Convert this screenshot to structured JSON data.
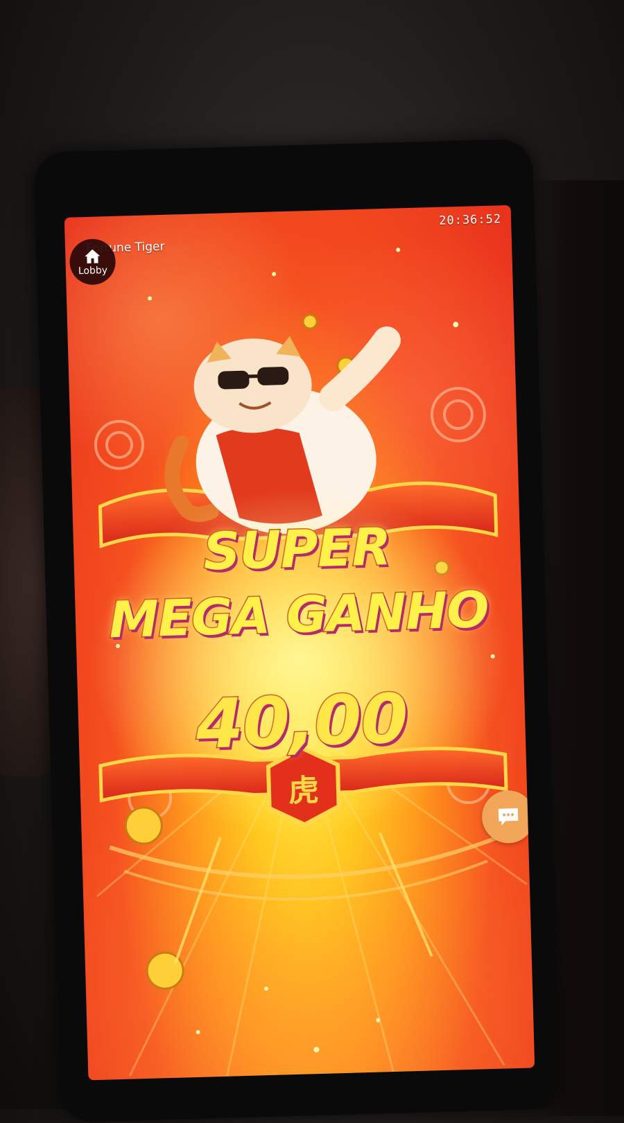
{
  "status_bar": {
    "time": "20:36:52"
  },
  "header": {
    "game_title": "Fortune Tiger",
    "lobby_label": "Lobby"
  },
  "win": {
    "line1": "SUPER",
    "line2": "MEGA GANHO",
    "amount": "40,00"
  },
  "emblem_char": "虎",
  "colors": {
    "background_red": "#e8321d",
    "center_yellow": "#ffe93a",
    "banner_red": "#e5411c",
    "gold": "#ffd23a",
    "chat_button": "#f2a65a"
  },
  "icons": {
    "lobby": "home-icon",
    "chat": "chat-bubble-icon"
  }
}
